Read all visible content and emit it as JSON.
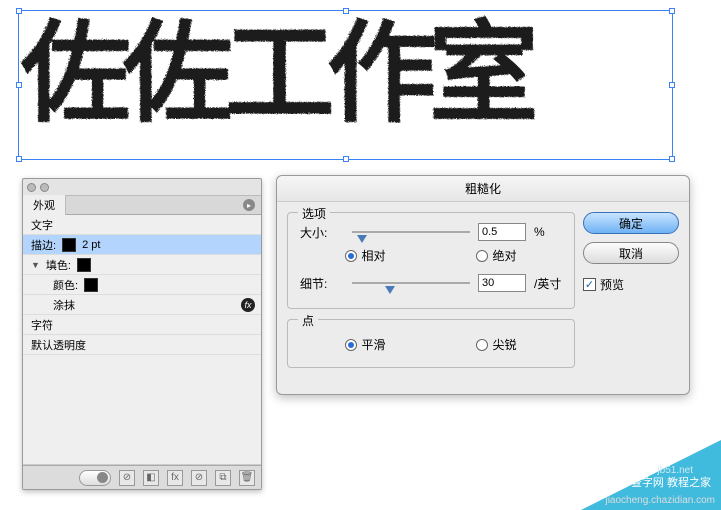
{
  "canvas": {
    "text": "佐佐工作室"
  },
  "appearance": {
    "tab": "外观",
    "rows": {
      "text": "文字",
      "stroke_label": "描边:",
      "stroke_value": "2 pt",
      "fill_label": "填色:",
      "color_label": "颜色:",
      "scribble": "涂抹",
      "char": "字符",
      "opacity": "默认透明度"
    }
  },
  "dialog": {
    "title": "粗糙化",
    "options_group": "选项",
    "size_label": "大小:",
    "size_value": "0.5",
    "size_unit": "%",
    "relative": "相对",
    "absolute": "绝对",
    "detail_label": "细节:",
    "detail_value": "30",
    "detail_unit": "/英寸",
    "points_group": "点",
    "smooth": "平滑",
    "corner": "尖锐",
    "ok": "确定",
    "cancel": "取消",
    "preview": "预览"
  },
  "watermark": {
    "site1": "jb51.net",
    "site2": "查字网 教程之家",
    "site3": "jiaocheng.chazidian.com"
  }
}
